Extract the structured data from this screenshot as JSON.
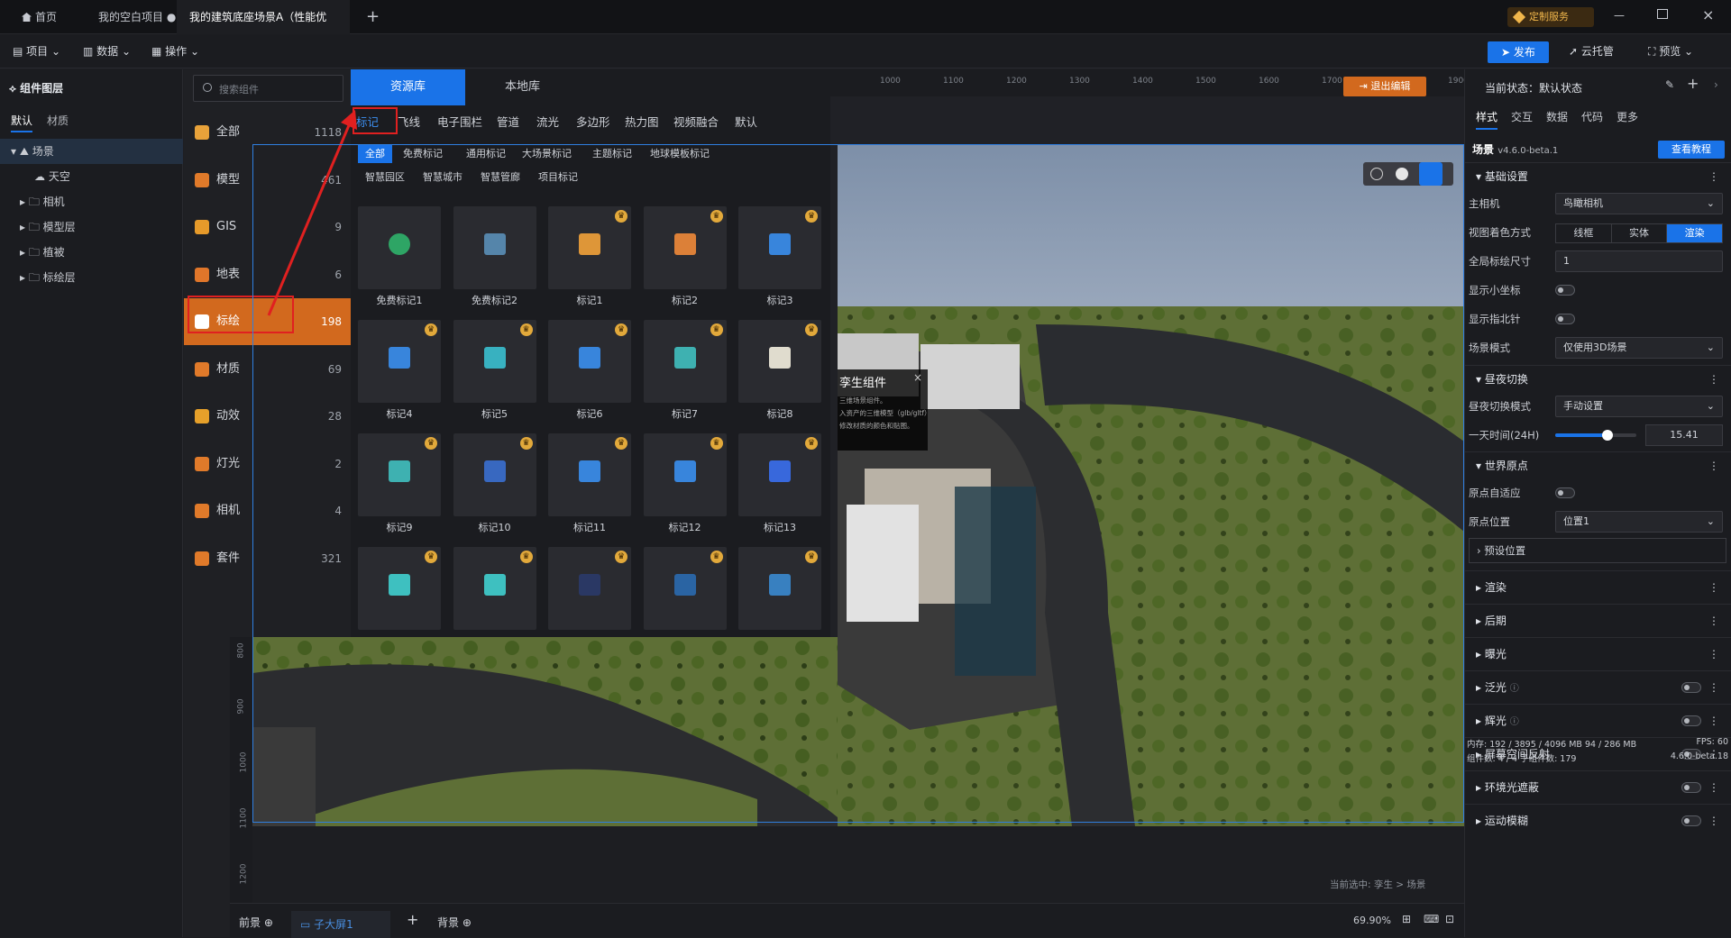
{
  "tabs": [
    {
      "label": "首页"
    },
    {
      "label": "我的空白项目 ●"
    },
    {
      "label": "我的建筑底座场景A（性能优先）"
    }
  ],
  "topbar": {
    "custom_service": "定制服务"
  },
  "menu": {
    "project": "项目",
    "data": "数据",
    "operate": "操作",
    "publish": "发布",
    "cloud": "云托管",
    "preview": "预览"
  },
  "layers": {
    "title": "组件图层",
    "tabs": [
      "默认",
      "材质"
    ],
    "items": [
      {
        "label": "场景"
      },
      {
        "label": "天空"
      },
      {
        "label": "相机"
      },
      {
        "label": "模型层"
      },
      {
        "label": "植被"
      },
      {
        "label": "标绘层"
      }
    ]
  },
  "search": {
    "placeholder": "搜索组件"
  },
  "categories": [
    {
      "label": "全部",
      "count": "1118"
    },
    {
      "label": "模型",
      "count": "461"
    },
    {
      "label": "GIS",
      "count": "9"
    },
    {
      "label": "地表",
      "count": "6"
    },
    {
      "label": "标绘",
      "count": "198"
    },
    {
      "label": "材质",
      "count": "69"
    },
    {
      "label": "动效",
      "count": "28"
    },
    {
      "label": "灯光",
      "count": "2"
    },
    {
      "label": "相机",
      "count": "4"
    },
    {
      "label": "套件",
      "count": "321"
    }
  ],
  "library": {
    "tab_resource": "资源库",
    "tab_local": "本地库",
    "subtabs": [
      "标记",
      "飞线",
      "电子围栏",
      "管道",
      "流光",
      "多边形",
      "热力图",
      "视频融合",
      "默认"
    ],
    "filters_row1": [
      "全部",
      "免费标记",
      "通用标记",
      "大场景标记",
      "主题标记",
      "地球模板标记"
    ],
    "filters_row2": [
      "智慧园区",
      "智慧城市",
      "智慧管廊",
      "项目标记"
    ],
    "cards": [
      "免费标记1",
      "免费标记2",
      "标记1",
      "标记2",
      "标记3",
      "标记4",
      "标记5",
      "标记6",
      "标记7",
      "标记8",
      "标记9",
      "标记10",
      "标记11",
      "标记12",
      "标记13",
      "",
      "",
      "",
      "",
      ""
    ]
  },
  "ruler": {
    "marks": [
      "1000",
      "1100",
      "1200",
      "1300",
      "1400",
      "1500",
      "1600",
      "1700",
      "1800",
      "1900"
    ]
  },
  "vruler": {
    "marks": [
      "800",
      "900",
      "1000",
      "1100",
      "1200"
    ]
  },
  "exit_edit": "退出编辑",
  "twin_popup": {
    "title": "孪生组件",
    "lines": [
      "三维场景组件。",
      "入资产的三维模型（glb/gltf）",
      "修改材质的颜色和贴图。"
    ]
  },
  "right": {
    "current_state": "当前状态：默认状态",
    "tabs": [
      "样式",
      "交互",
      "数据",
      "代码",
      "更多"
    ],
    "scene_title": "场景",
    "version": "v4.6.0-beta.1",
    "tutorial": "查看教程",
    "sections": {
      "basic": "基础设置",
      "daynight": "昼夜切换",
      "origin": "世界原点",
      "preset": "预设位置",
      "render": "渲染",
      "post": "后期",
      "exposure": "曝光",
      "bloom": "泛光",
      "glow": "辉光",
      "ssr": "屏幕空间反射",
      "ao": "环境光遮蔽",
      "motionblur": "运动模糊"
    },
    "props": {
      "main_camera_label": "主相机",
      "main_camera_value": "鸟瞰相机",
      "shading_label": "视图着色方式",
      "shading_options": [
        "线框",
        "实体",
        "渲染"
      ],
      "global_size_label": "全局标绘尺寸",
      "global_size_value": "1",
      "show_axes_label": "显示小坐标",
      "show_compass_label": "显示指北针",
      "scene_mode_label": "场景模式",
      "scene_mode_value": "仅使用3D场景",
      "daynight_mode_label": "昼夜切换模式",
      "daynight_mode_value": "手动设置",
      "time_label": "一天时间(24H)",
      "time_value": "15.41",
      "time_fraction": 0.64,
      "origin_auto_label": "原点自适应",
      "origin_pos_label": "原点位置",
      "origin_pos_value": "位置1"
    }
  },
  "bottom": {
    "front": "前景",
    "screen": "子大屏1",
    "back": "背景",
    "zoom": "69.90%",
    "selected": "当前选中: 孪生 > 场景",
    "mem": "内存: 192 / 3895 / 4096 MB  94 / 286 MB",
    "fps": "FPS: 60",
    "components": "组件数: 4 / 4   子组件数: 179",
    "version": "4.6.0-beta.18"
  },
  "colors": {
    "accent": "#1a73e8",
    "orange": "#d2691e",
    "highlight": "#e02020"
  }
}
